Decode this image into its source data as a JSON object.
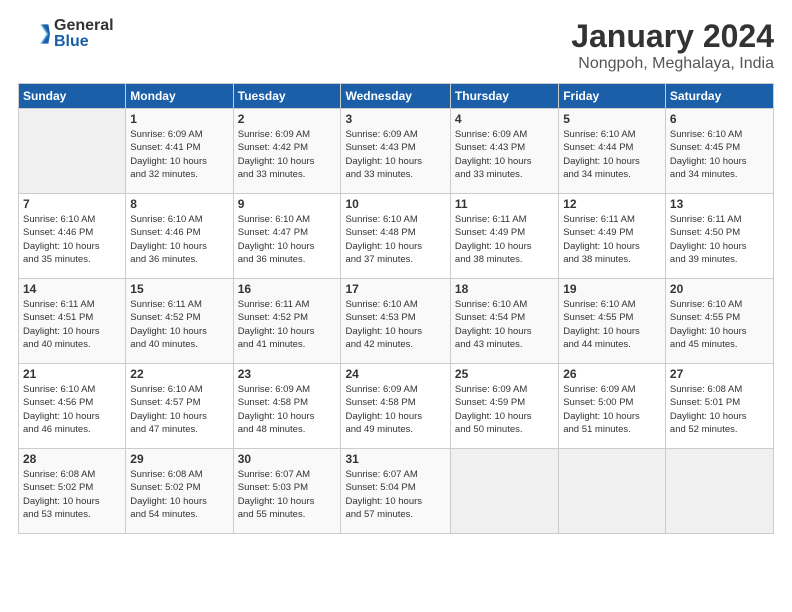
{
  "header": {
    "logo_general": "General",
    "logo_blue": "Blue",
    "month_year": "January 2024",
    "location": "Nongpoh, Meghalaya, India"
  },
  "days_of_week": [
    "Sunday",
    "Monday",
    "Tuesday",
    "Wednesday",
    "Thursday",
    "Friday",
    "Saturday"
  ],
  "weeks": [
    [
      {
        "day": "",
        "info": ""
      },
      {
        "day": "1",
        "info": "Sunrise: 6:09 AM\nSunset: 4:41 PM\nDaylight: 10 hours\nand 32 minutes."
      },
      {
        "day": "2",
        "info": "Sunrise: 6:09 AM\nSunset: 4:42 PM\nDaylight: 10 hours\nand 33 minutes."
      },
      {
        "day": "3",
        "info": "Sunrise: 6:09 AM\nSunset: 4:43 PM\nDaylight: 10 hours\nand 33 minutes."
      },
      {
        "day": "4",
        "info": "Sunrise: 6:09 AM\nSunset: 4:43 PM\nDaylight: 10 hours\nand 33 minutes."
      },
      {
        "day": "5",
        "info": "Sunrise: 6:10 AM\nSunset: 4:44 PM\nDaylight: 10 hours\nand 34 minutes."
      },
      {
        "day": "6",
        "info": "Sunrise: 6:10 AM\nSunset: 4:45 PM\nDaylight: 10 hours\nand 34 minutes."
      }
    ],
    [
      {
        "day": "7",
        "info": "Sunrise: 6:10 AM\nSunset: 4:46 PM\nDaylight: 10 hours\nand 35 minutes."
      },
      {
        "day": "8",
        "info": "Sunrise: 6:10 AM\nSunset: 4:46 PM\nDaylight: 10 hours\nand 36 minutes."
      },
      {
        "day": "9",
        "info": "Sunrise: 6:10 AM\nSunset: 4:47 PM\nDaylight: 10 hours\nand 36 minutes."
      },
      {
        "day": "10",
        "info": "Sunrise: 6:10 AM\nSunset: 4:48 PM\nDaylight: 10 hours\nand 37 minutes."
      },
      {
        "day": "11",
        "info": "Sunrise: 6:11 AM\nSunset: 4:49 PM\nDaylight: 10 hours\nand 38 minutes."
      },
      {
        "day": "12",
        "info": "Sunrise: 6:11 AM\nSunset: 4:49 PM\nDaylight: 10 hours\nand 38 minutes."
      },
      {
        "day": "13",
        "info": "Sunrise: 6:11 AM\nSunset: 4:50 PM\nDaylight: 10 hours\nand 39 minutes."
      }
    ],
    [
      {
        "day": "14",
        "info": "Sunrise: 6:11 AM\nSunset: 4:51 PM\nDaylight: 10 hours\nand 40 minutes."
      },
      {
        "day": "15",
        "info": "Sunrise: 6:11 AM\nSunset: 4:52 PM\nDaylight: 10 hours\nand 40 minutes."
      },
      {
        "day": "16",
        "info": "Sunrise: 6:11 AM\nSunset: 4:52 PM\nDaylight: 10 hours\nand 41 minutes."
      },
      {
        "day": "17",
        "info": "Sunrise: 6:10 AM\nSunset: 4:53 PM\nDaylight: 10 hours\nand 42 minutes."
      },
      {
        "day": "18",
        "info": "Sunrise: 6:10 AM\nSunset: 4:54 PM\nDaylight: 10 hours\nand 43 minutes."
      },
      {
        "day": "19",
        "info": "Sunrise: 6:10 AM\nSunset: 4:55 PM\nDaylight: 10 hours\nand 44 minutes."
      },
      {
        "day": "20",
        "info": "Sunrise: 6:10 AM\nSunset: 4:55 PM\nDaylight: 10 hours\nand 45 minutes."
      }
    ],
    [
      {
        "day": "21",
        "info": "Sunrise: 6:10 AM\nSunset: 4:56 PM\nDaylight: 10 hours\nand 46 minutes."
      },
      {
        "day": "22",
        "info": "Sunrise: 6:10 AM\nSunset: 4:57 PM\nDaylight: 10 hours\nand 47 minutes."
      },
      {
        "day": "23",
        "info": "Sunrise: 6:09 AM\nSunset: 4:58 PM\nDaylight: 10 hours\nand 48 minutes."
      },
      {
        "day": "24",
        "info": "Sunrise: 6:09 AM\nSunset: 4:58 PM\nDaylight: 10 hours\nand 49 minutes."
      },
      {
        "day": "25",
        "info": "Sunrise: 6:09 AM\nSunset: 4:59 PM\nDaylight: 10 hours\nand 50 minutes."
      },
      {
        "day": "26",
        "info": "Sunrise: 6:09 AM\nSunset: 5:00 PM\nDaylight: 10 hours\nand 51 minutes."
      },
      {
        "day": "27",
        "info": "Sunrise: 6:08 AM\nSunset: 5:01 PM\nDaylight: 10 hours\nand 52 minutes."
      }
    ],
    [
      {
        "day": "28",
        "info": "Sunrise: 6:08 AM\nSunset: 5:02 PM\nDaylight: 10 hours\nand 53 minutes."
      },
      {
        "day": "29",
        "info": "Sunrise: 6:08 AM\nSunset: 5:02 PM\nDaylight: 10 hours\nand 54 minutes."
      },
      {
        "day": "30",
        "info": "Sunrise: 6:07 AM\nSunset: 5:03 PM\nDaylight: 10 hours\nand 55 minutes."
      },
      {
        "day": "31",
        "info": "Sunrise: 6:07 AM\nSunset: 5:04 PM\nDaylight: 10 hours\nand 57 minutes."
      },
      {
        "day": "",
        "info": ""
      },
      {
        "day": "",
        "info": ""
      },
      {
        "day": "",
        "info": ""
      }
    ]
  ]
}
